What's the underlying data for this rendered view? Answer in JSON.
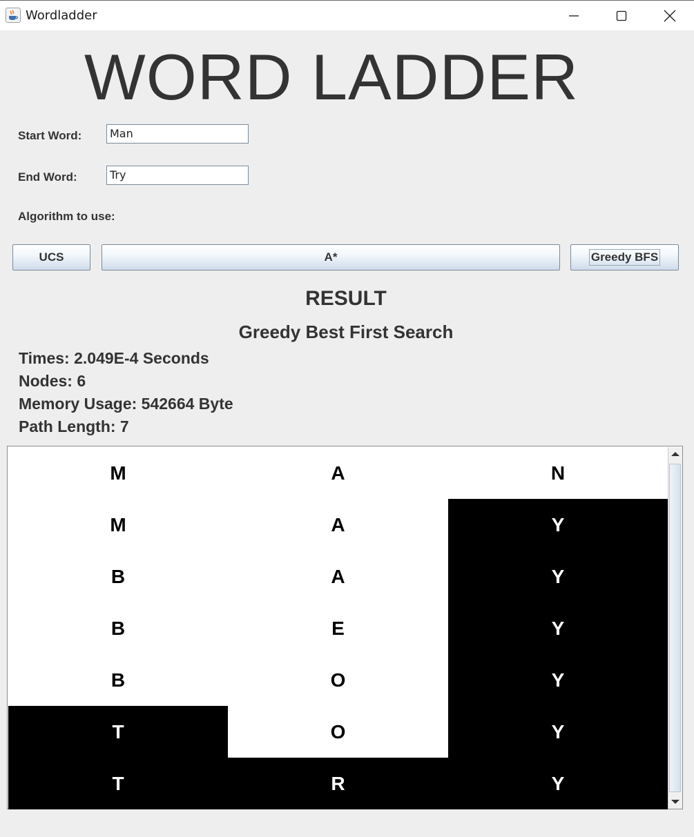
{
  "window": {
    "title": "Wordladder",
    "app_icon": "java-cup-icon",
    "controls": [
      "minimize-icon",
      "maximize-icon",
      "close-icon"
    ]
  },
  "header": {
    "title": "WORD LADDER"
  },
  "form": {
    "start_label": "Start Word:",
    "start_value": "Man",
    "end_label": "End Word:",
    "end_value": "Try",
    "algorithm_label": "Algorithm to use:"
  },
  "buttons": {
    "ucs": "UCS",
    "astar": "A*",
    "greedy": "Greedy BFS"
  },
  "result": {
    "heading": "RESULT",
    "algorithm": "Greedy Best First Search",
    "time": "Times: 2.049E-4 Seconds",
    "nodes": "Nodes: 6",
    "memory": "Memory Usage: 542664 Byte",
    "path_length": "Path Length: 7"
  },
  "ladder": {
    "rows": [
      [
        {
          "letter": "M",
          "dark": false
        },
        {
          "letter": "A",
          "dark": false
        },
        {
          "letter": "N",
          "dark": false
        }
      ],
      [
        {
          "letter": "M",
          "dark": false
        },
        {
          "letter": "A",
          "dark": false
        },
        {
          "letter": "Y",
          "dark": true
        }
      ],
      [
        {
          "letter": "B",
          "dark": false
        },
        {
          "letter": "A",
          "dark": false
        },
        {
          "letter": "Y",
          "dark": true
        }
      ],
      [
        {
          "letter": "B",
          "dark": false
        },
        {
          "letter": "E",
          "dark": false
        },
        {
          "letter": "Y",
          "dark": true
        }
      ],
      [
        {
          "letter": "B",
          "dark": false
        },
        {
          "letter": "O",
          "dark": false
        },
        {
          "letter": "Y",
          "dark": true
        }
      ],
      [
        {
          "letter": "T",
          "dark": true
        },
        {
          "letter": "O",
          "dark": false
        },
        {
          "letter": "Y",
          "dark": true
        }
      ],
      [
        {
          "letter": "T",
          "dark": true
        },
        {
          "letter": "R",
          "dark": true
        },
        {
          "letter": "Y",
          "dark": true
        }
      ]
    ]
  },
  "colors": {
    "background": "#eeeeee",
    "text": "#333333",
    "highlight": "#000000",
    "cell": "#ffffff"
  }
}
